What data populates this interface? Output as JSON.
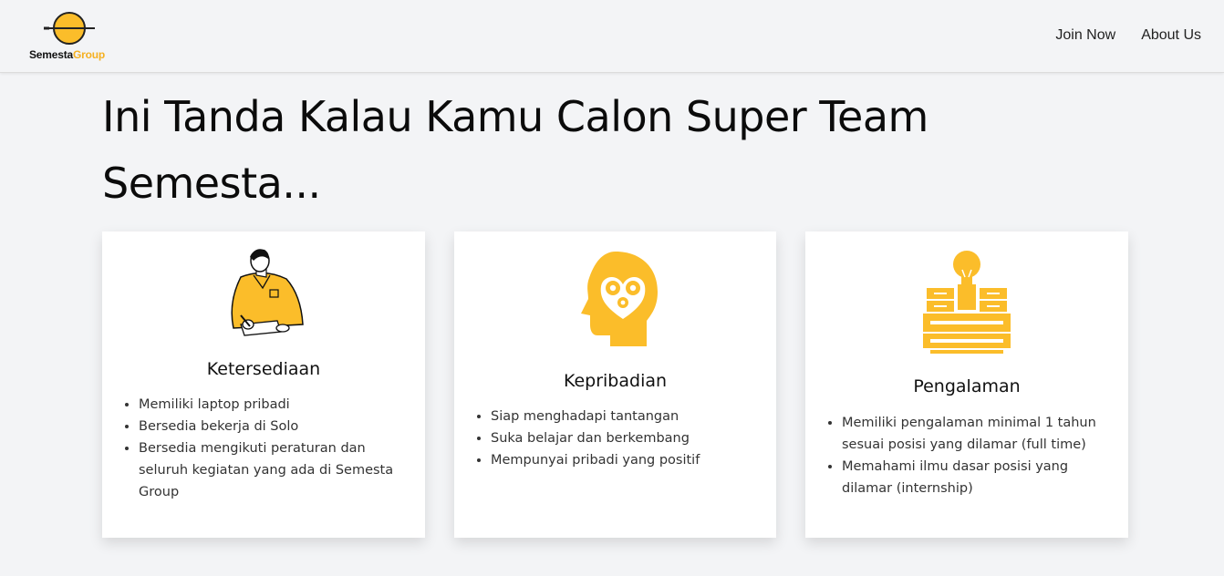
{
  "header": {
    "logo": {
      "part1": "Semesta",
      "part2": "Group",
      "accent": "#f5b021"
    },
    "nav": [
      {
        "label": "Join Now"
      },
      {
        "label": "About Us"
      }
    ]
  },
  "hero": {
    "title_line1": "Ini Tanda Kalau Kamu Calon Super Team",
    "title_line2": "Semesta..."
  },
  "cards": [
    {
      "title": "Ketersediaan",
      "icon": "person-writing-illustration",
      "items": [
        "Memiliki laptop pribadi",
        "Bersedia bekerja di Solo",
        "Bersedia mengikuti peraturan dan seluruh kegiatan yang ada di Semesta Group"
      ]
    },
    {
      "title": "Kepribadian",
      "icon": "head-with-gears-icon",
      "items": [
        "Siap menghadapi tantangan",
        "Suka belajar dan berkembang",
        "Mempunyai pribadi yang positif"
      ]
    },
    {
      "title": "Pengalaman",
      "icon": "lightbulb-drawers-icon",
      "items": [
        "Memiliki pengalaman minimal 1 tahun sesuai posisi yang dilamar (full time)",
        "Memahami ilmu dasar posisi yang dilamar (internship)"
      ]
    }
  ],
  "colors": {
    "accent": "#fbbd2a",
    "background": "#f3f4f6",
    "card": "#ffffff"
  }
}
